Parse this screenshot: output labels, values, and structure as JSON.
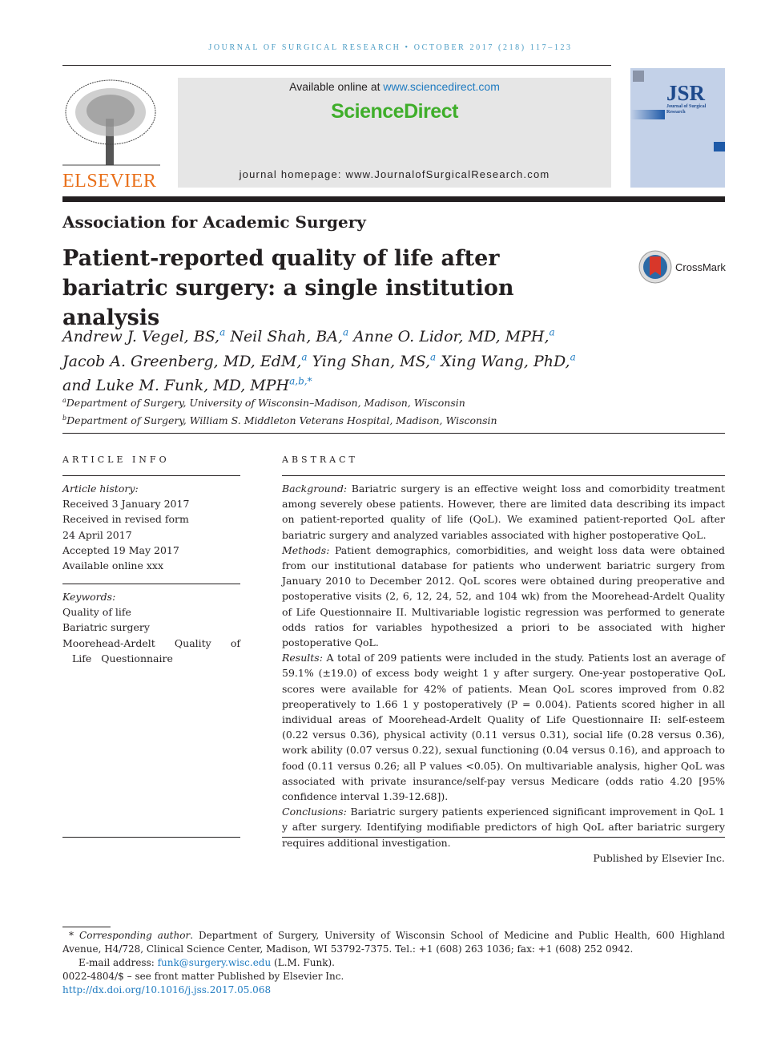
{
  "journal_header": "JOURNAL OF SURGICAL RESEARCH • OCTOBER 2017 (218) 117–123",
  "banner": {
    "available_prefix": "Available online at ",
    "available_link": "www.sciencedirect.com",
    "brand": "ScienceDirect",
    "homepage": "journal homepage: www.JournalofSurgicalResearch.com"
  },
  "publisher_logo_text": "ELSEVIER",
  "cover_text": "JSR Journal of Surgical Research",
  "society": "Association for Academic Surgery",
  "title": "Patient-reported quality of life after bariatric surgery: a single institution analysis",
  "crossmark": "CrossMark",
  "authors": [
    {
      "name": "Andrew J. Vegel, BS,",
      "sup": "a"
    },
    {
      "name": "Neil Shah, BA,",
      "sup": "a"
    },
    {
      "name": "Anne O. Lidor, MD, MPH,",
      "sup": "a"
    },
    {
      "name": "Jacob A. Greenberg, MD, EdM,",
      "sup": "a"
    },
    {
      "name": "Ying Shan, MS,",
      "sup": "a"
    },
    {
      "name": "Xing Wang, PhD,",
      "sup": "a"
    },
    {
      "name": "and Luke M. Funk, MD, MPH",
      "sup": "a,b,*"
    }
  ],
  "affiliations": [
    {
      "sup": "a",
      "text": "Department of Surgery, University of Wisconsin–Madison, Madison, Wisconsin"
    },
    {
      "sup": "b",
      "text": "Department of Surgery, William S. Middleton Veterans Hospital, Madison, Wisconsin"
    }
  ],
  "article_info": {
    "heading": "ARTICLE INFO",
    "history_label": "Article history:",
    "history": [
      "Received 3 January 2017",
      "Received in revised form",
      "24 April 2017",
      "Accepted 19 May 2017",
      "Available online xxx"
    ],
    "keywords_label": "Keywords:",
    "keywords": [
      "Quality of life",
      "Bariatric surgery",
      "Moorehead-Ardelt Quality of Life Questionnaire"
    ]
  },
  "abstract": {
    "heading": "ABSTRACT",
    "sections": [
      {
        "label": "Background:",
        "text": " Bariatric surgery is an effective weight loss and comorbidity treatment among severely obese patients. However, there are limited data describing its impact on patient-reported quality of life (QoL). We examined patient-reported QoL after bariatric surgery and analyzed variables associated with higher postoperative QoL."
      },
      {
        "label": "Methods:",
        "text": " Patient demographics, comorbidities, and weight loss data were obtained from our institutional database for patients who underwent bariatric surgery from January 2010 to December 2012. QoL scores were obtained during preoperative and postoperative visits (2, 6, 12, 24, 52, and 104 wk) from the Moorehead-Ardelt Quality of Life Questionnaire II. Multivariable logistic regression was performed to generate odds ratios for variables hypothesized a priori to be associated with higher postoperative QoL."
      },
      {
        "label": "Results:",
        "text": " A total of 209 patients were included in the study. Patients lost an average of 59.1% (±19.0) of excess body weight 1 y after surgery. One-year postoperative QoL scores were available for 42% of patients. Mean QoL scores improved from 0.82 preoperatively to 1.66 1 y postoperatively (P = 0.004). Patients scored higher in all individual areas of Moorehead-Ardelt Quality of Life Questionnaire II: self-esteem (0.22 versus 0.36), physical activity (0.11 versus 0.31), social life (0.28 versus 0.36), work ability (0.07 versus 0.22), sexual functioning (0.04 versus 0.16), and approach to food (0.11 versus 0.26; all P values <0.05). On multivariable analysis, higher QoL was associated with private insurance/self-pay versus Medicare (odds ratio 4.20 [95% confidence interval 1.39-12.68])."
      },
      {
        "label": "Conclusions:",
        "text": " Bariatric surgery patients experienced significant improvement in QoL 1 y after surgery. Identifying modifiable predictors of high QoL after bariatric surgery requires additional investigation."
      }
    ],
    "published_by": "Published by Elsevier Inc."
  },
  "footnote": {
    "corr_label": "Corresponding author",
    "corr_text": ". Department of Surgery, University of Wisconsin School of Medicine and Public Health, 600 Highland Avenue, H4/728, Clinical Science Center, Madison, WI 53792-7375. Tel.: +1 (608) 263 1036; fax: +1 (608) 252 0942.",
    "email_label": "E-mail address: ",
    "email": "funk@surgery.wisc.edu",
    "email_suffix": " (L.M. Funk).",
    "issn": "0022-4804/$ – see front matter Published by Elsevier Inc.",
    "doi": "http://dx.doi.org/10.1016/j.jss.2017.05.068"
  }
}
